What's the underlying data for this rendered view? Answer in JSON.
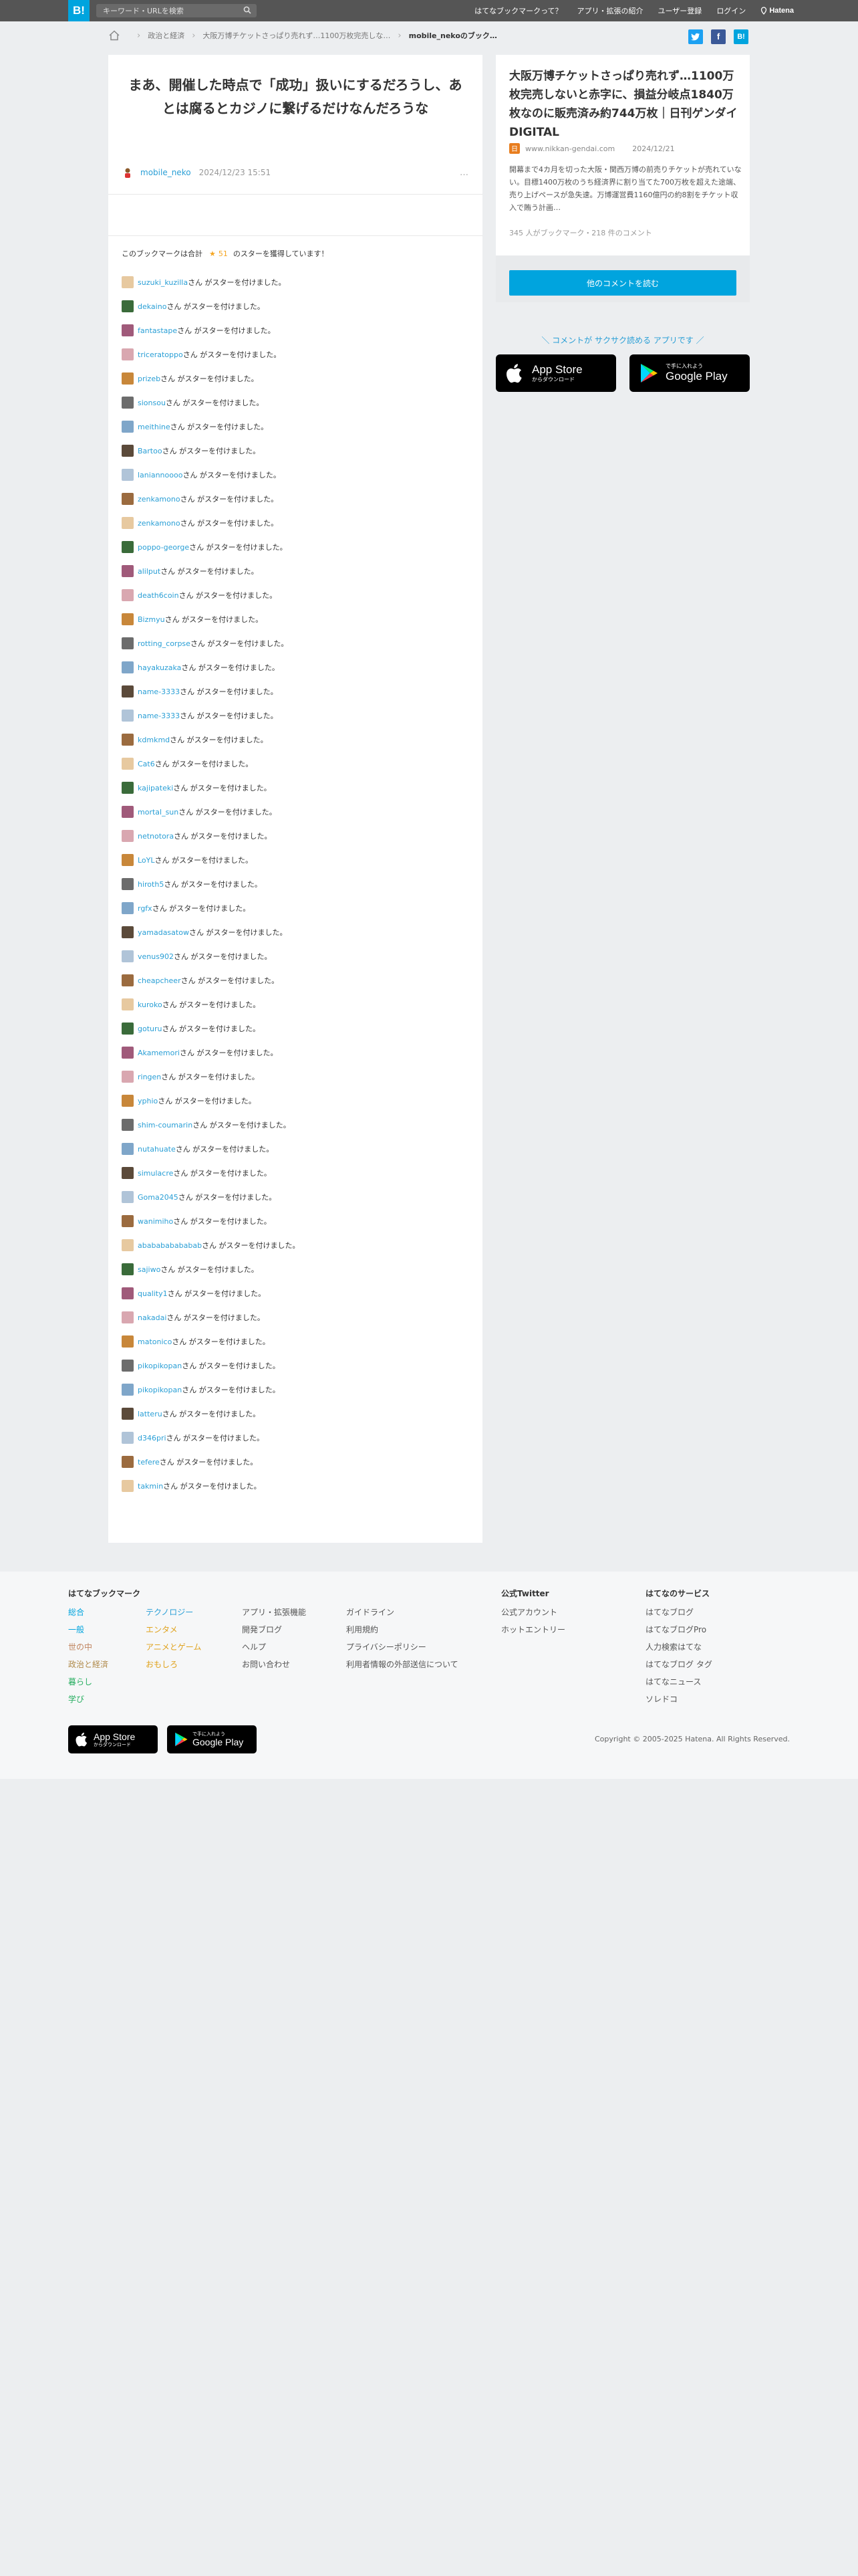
{
  "header": {
    "logo": "B!",
    "search_placeholder": "キーワード・URLを検索",
    "nav": [
      "はてなブックマークって？",
      "アプリ・拡張の紹介",
      "ユーザー登録",
      "ログイン"
    ],
    "hatena_label": "Hatena"
  },
  "breadcrumb": {
    "items": [
      "政治と経済",
      "大阪万博チケットさっぱり売れず…1100万枚完売しな…"
    ],
    "current": "mobile_nekoのブック…"
  },
  "share": [
    "twitter",
    "facebook",
    "hatena-bookmark"
  ],
  "bookmark": {
    "title": "まあ、開催した時点で「成功」扱いにするだろうし、あとは腐るとカジノに繋げるだけなんだろうな",
    "user": "mobile_neko",
    "date": "2024/12/23 15:51",
    "more": "…"
  },
  "star_summary": {
    "prefix": "このブックマークは合計",
    "star_icon": "★",
    "count": "51",
    "suffix": "のスターを獲得しています！"
  },
  "star_suffix": "さん がスターを付けました。",
  "stars": [
    "suzuki_kuzilla",
    "dekaino",
    "fantastape",
    "triceratoppo",
    "prizeb",
    "sionsou",
    "meithine",
    "Bartoo",
    "laniannoooo",
    "zenkamono",
    "zenkamono",
    "poppo-george",
    "alilput",
    "death6coin",
    "Bizmyu",
    "rotting_corpse",
    "hayakuzaka",
    "name-3333",
    "name-3333",
    "kdmkmd",
    "Cat6",
    "kajipateki",
    "mortal_sun",
    "netnotora",
    "LoYL",
    "hiroth5",
    "rgfx",
    "yamadasatow",
    "venus902",
    "cheapcheer",
    "kuroko",
    "goturu",
    "Akamemori",
    "ringen",
    "yphio",
    "shim-coumarin",
    "nutahuate",
    "simulacre",
    "Goma2045",
    "wanimiho",
    "ababababababab",
    "sajiwo",
    "quality1",
    "nakadai",
    "matonico",
    "pikopikopan",
    "pikopikopan",
    "latteru",
    "d346pri",
    "tefere",
    "takmin"
  ],
  "entry": {
    "title": "大阪万博チケットさっぱり売れず…1100万枚完売しないと赤字に、損益分岐点1840万枚なのに販売済み約744万枚｜日刊ゲンダイDIGITAL",
    "domain": "www.nikkan-gendai.com",
    "date": "2024/12/21",
    "summary": "開幕まで4カ月を切った大阪・関西万博の前売りチケットが売れていない。目標1400万枚のうち経済界に割り当てた700万枚を超えた途端、売り上げペースが急失速。万博運営費1160億円の約8割をチケット収入で賄う計画…",
    "meta": "345 人がブックマーク・218 件のコメント",
    "more_button": "他のコメントを読む"
  },
  "app_promo": {
    "text": "コメントが サクサク読める アプリです",
    "appstore_small": "からダウンロード",
    "appstore_large": "App Store",
    "googleplay_small": "で手に入れよう",
    "googleplay_large": "Google Play"
  },
  "footer": {
    "col1_title": "はてなブックマーク",
    "col1a": [
      "総合",
      "一般",
      "世の中",
      "政治と経済",
      "暮らし",
      "学び"
    ],
    "col1b": [
      "テクノロジー",
      "エンタメ",
      "アニメとゲーム",
      "おもしろ"
    ],
    "col2": [
      "アプリ・拡張機能",
      "開発ブログ",
      "ヘルプ",
      "お問い合わせ"
    ],
    "col3": [
      "ガイドライン",
      "利用規約",
      "プライバシーポリシー",
      "利用者情報の外部送信について"
    ],
    "col4_title": "公式Twitter",
    "col4": [
      "公式アカウント",
      "ホットエントリー"
    ],
    "col5_title": "はてなのサービス",
    "col5": [
      "はてなブログ",
      "はてなブログPro",
      "人力検索はてな",
      "はてなブログ タグ",
      "はてなニュース",
      "ソレドコ"
    ],
    "copyright": "Copyright © 2005-2025 Hatena. All Rights Reserved."
  },
  "colors": {
    "accent": "#00a4de",
    "link": "#2a9fd6",
    "star": "#f5a623"
  }
}
